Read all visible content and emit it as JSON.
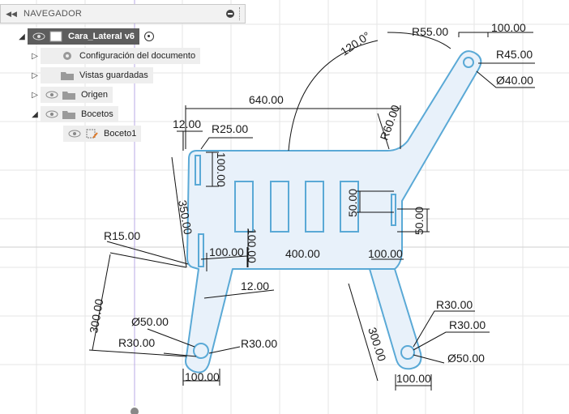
{
  "navigator": {
    "title": "NAVEGADOR",
    "items": [
      {
        "label": "Cara_Lateral v6",
        "expanded": true,
        "icon": "component-icon"
      },
      {
        "label": "Configuración del documento",
        "expanded": false,
        "icon": "gear-icon"
      },
      {
        "label": "Vistas guardadas",
        "expanded": false,
        "icon": "folder-icon"
      },
      {
        "label": "Origen",
        "expanded": false,
        "icon": "folder-icon"
      },
      {
        "label": "Bocetos",
        "expanded": true,
        "icon": "folder-icon"
      },
      {
        "label": "Boceto1",
        "icon": "sketch-icon"
      }
    ]
  },
  "dimensions": {
    "d640": "640.00",
    "d120deg": "120.0°",
    "r55": "R55.00",
    "d100_top": "100.00",
    "r45": "R45.00",
    "dia40": "Ø40.00",
    "r60": "R60.00",
    "d12_top": "12.00",
    "r25": "R25.00",
    "d100_slot": "100.00",
    "d350": "350.00",
    "d50_a": "50.00",
    "d50_b": "50.00",
    "r15": "R15.00",
    "d100_h": "100.00",
    "d100_v": "100.00",
    "d400": "400.00",
    "d100_r": "100.00",
    "d12_bottom": "12.00",
    "d300_left": "300.00",
    "dia50_left": "Ø50.00",
    "r30_left_a": "R30.00",
    "r30_left_b": "R30.00",
    "d100_bl": "100.00",
    "d300_right": "300.00",
    "r30_right_a": "R30.00",
    "r30_right_b": "R30.00",
    "dia50_right": "Ø50.00",
    "d100_br": "100.00"
  },
  "colors": {
    "profile_fill": "#e8f1fa",
    "profile_stroke": "#5aa9d6",
    "grid": "#e3e3e3",
    "axis_vertical": "#b9a9e6"
  }
}
